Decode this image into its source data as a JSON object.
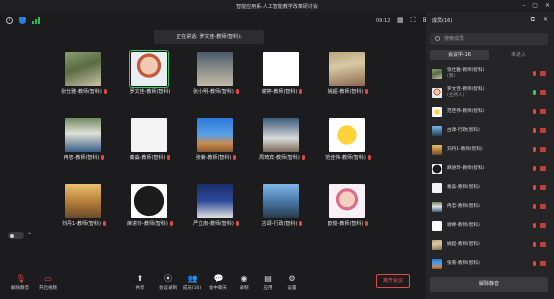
{
  "window": {
    "title": "智能应用系-人工智能教学改革研讨会"
  },
  "top": {
    "time": "09:12"
  },
  "speaking": {
    "label": "正在讲话: 罗文佳-教师(智科);"
  },
  "participants_grid": [
    {
      "name": "张仕雅-教师(智科)",
      "art": "a1",
      "muted": true,
      "active": false
    },
    {
      "name": "罗文佳-教师(智科)",
      "art": "a2",
      "muted": false,
      "active": true
    },
    {
      "name": "张小明-教师(智科)",
      "art": "a3",
      "muted": true,
      "active": false
    },
    {
      "name": "谢婷-教师(智科)",
      "art": "a4",
      "muted": true,
      "active": false
    },
    {
      "name": "姚超-教师(智科)",
      "art": "a5",
      "muted": true,
      "active": false
    },
    {
      "name": "冉忠-教师(智科)",
      "art": "a6",
      "muted": true,
      "active": false
    },
    {
      "name": "秦淼-教师(智科)",
      "art": "a7",
      "muted": true,
      "active": false
    },
    {
      "name": "张菊-教师(智科)",
      "art": "a8",
      "muted": true,
      "active": false
    },
    {
      "name": "周琦宾-教师(智科)",
      "art": "a9",
      "muted": true,
      "active": false
    },
    {
      "name": "范佳伟-教师(智科)",
      "art": "a10",
      "muted": true,
      "active": false
    },
    {
      "name": "刘丹1-教师(智科)",
      "art": "a11",
      "muted": true,
      "active": false
    },
    {
      "name": "麻进玲-教师(智科)",
      "art": "a12",
      "muted": true,
      "active": false
    },
    {
      "name": "严立南-教师(智科)",
      "art": "a13",
      "muted": true,
      "active": false
    },
    {
      "name": "古颂-行政(智科)",
      "art": "a14",
      "muted": true,
      "active": false
    },
    {
      "name": "欧俊-教师(智科)",
      "art": "a15",
      "muted": true,
      "active": false
    }
  ],
  "toolbar": {
    "mute_label": "解除静音",
    "video_label": "开启视频",
    "share_label": "共享",
    "record_label": "会议录制",
    "members_label": "成员(16)",
    "chat_label": "会中聊天",
    "whiteboard_label": "录制",
    "apps_label": "应用",
    "settings_label": "设置",
    "leave_label": "离开会议"
  },
  "panel": {
    "title": "成员(16)",
    "search_placeholder": "搜索成员",
    "tab_in_meeting": "会议中·16",
    "tab_not_joined": "未进入",
    "mute_all_label": "解除静音",
    "members": [
      {
        "name": "张仕雅-教师(智科)",
        "sub": "(我)",
        "art": "a1",
        "mic": "red"
      },
      {
        "name": "罗文佳-教师(智科)",
        "sub": "(主持人)",
        "art": "a2",
        "mic": "green"
      },
      {
        "name": "范佳伟-教师(智科)",
        "sub": "",
        "art": "a10",
        "mic": "red"
      },
      {
        "name": "古颂-行政(智科)",
        "sub": "",
        "art": "a14",
        "mic": "red"
      },
      {
        "name": "刘丹1-教师(智科)",
        "sub": "",
        "art": "a11",
        "mic": "red"
      },
      {
        "name": "麻进玲-教师(智科)",
        "sub": "",
        "art": "a12",
        "mic": "red"
      },
      {
        "name": "秦淼-教师(智科)",
        "sub": "",
        "art": "a7",
        "mic": "red"
      },
      {
        "name": "冉忠-教师(智科)",
        "sub": "",
        "art": "a6",
        "mic": "red"
      },
      {
        "name": "谢婷-教师(智科)",
        "sub": "",
        "art": "a4",
        "mic": "red"
      },
      {
        "name": "姚超-教师(智科)",
        "sub": "",
        "art": "a5",
        "mic": "red"
      },
      {
        "name": "张菊-教师(智科)",
        "sub": "",
        "art": "a8",
        "mic": "red"
      }
    ]
  }
}
